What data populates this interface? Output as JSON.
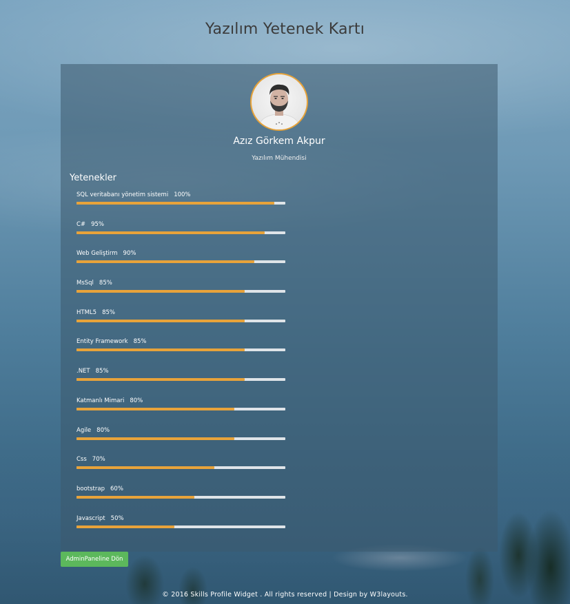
{
  "page": {
    "title": "Yazılım Yetenek Kartı"
  },
  "profile": {
    "name": "Azız Görkem Akpur",
    "role": "Yazılım Mühendisi",
    "avatar_icon": "user-photo"
  },
  "skills": {
    "heading": "Yetenekler",
    "items": [
      {
        "name": "SQL veritabanı yönetim sistemi",
        "percent_label": "100%",
        "percent": 100
      },
      {
        "name": "C#",
        "percent_label": "95%",
        "percent": 95
      },
      {
        "name": "Web Geliştirm",
        "percent_label": "90%",
        "percent": 90
      },
      {
        "name": "MsSql",
        "percent_label": "85%",
        "percent": 85
      },
      {
        "name": "HTML5",
        "percent_label": "85%",
        "percent": 85
      },
      {
        "name": "Entity Framework",
        "percent_label": "85%",
        "percent": 85
      },
      {
        "name": ".NET",
        "percent_label": "85%",
        "percent": 85
      },
      {
        "name": "Katmanlı Mimari",
        "percent_label": "80%",
        "percent": 80
      },
      {
        "name": "Agile",
        "percent_label": "80%",
        "percent": 80
      },
      {
        "name": "Css",
        "percent_label": "70%",
        "percent": 70
      },
      {
        "name": "bootstrap",
        "percent_label": "60%",
        "percent": 60
      },
      {
        "name": "Javascript",
        "percent_label": "50%",
        "percent": 50
      }
    ]
  },
  "actions": {
    "back_label": "AdminPaneline Dön"
  },
  "footer": {
    "text": "© 2016 Skills Profile Widget . All rights reserved | Design by W3layouts."
  },
  "colors": {
    "accent": "#e8a33a",
    "track": "#dfe4e8",
    "button": "#5cb85c"
  }
}
